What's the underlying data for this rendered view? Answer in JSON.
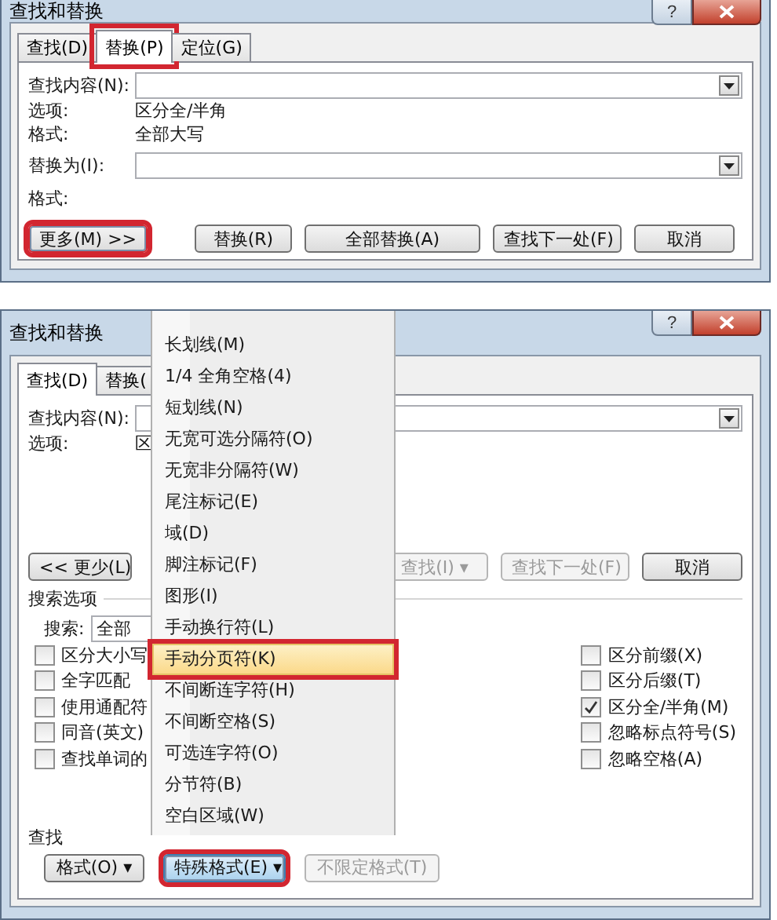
{
  "top_dialog": {
    "title": "查找和替换",
    "help": "?",
    "tabs": [
      {
        "label": "查找(D)",
        "selected": false,
        "highlighted": false
      },
      {
        "label": "替换(P)",
        "selected": true,
        "highlighted": true
      },
      {
        "label": "定位(G)",
        "selected": false,
        "highlighted": false
      }
    ],
    "find_label": "查找内容(N):",
    "options_label": "选项:",
    "options_value": "区分全/半角",
    "format_label": "格式:",
    "format_value": "全部大写",
    "replace_label": "替换为(I):",
    "replace_format_label": "格式:",
    "buttons": [
      {
        "label": "更多(M) >>",
        "highlighted": true,
        "disabled": false
      },
      {
        "label": "替换(R)",
        "highlighted": false,
        "disabled": false
      },
      {
        "label": "全部替换(A)",
        "highlighted": false,
        "disabled": false
      },
      {
        "label": "查找下一处(F)",
        "highlighted": false,
        "disabled": false
      },
      {
        "label": "取消",
        "highlighted": false,
        "disabled": false
      }
    ]
  },
  "bottom_dialog": {
    "title": "查找和替换",
    "help": "?",
    "tabs": [
      {
        "label": "查找(D)",
        "selected": true
      },
      {
        "label": "替换(",
        "selected": false
      }
    ],
    "find_label": "查找内容(N):",
    "options_label": "选项:",
    "options_value": "区",
    "less_button": "<< 更少(L)",
    "right_buttons": [
      {
        "label": "查找(I) ▾",
        "disabled": true
      },
      {
        "label": "查找下一处(F)",
        "disabled": true
      },
      {
        "label": "取消",
        "disabled": false
      }
    ],
    "search_options_title": "搜索选项",
    "search_label": "搜索:",
    "search_value": "全部",
    "left_checks": [
      {
        "label": "区分大小写",
        "checked": false
      },
      {
        "label": "全字匹配",
        "checked": false
      },
      {
        "label": "使用通配符",
        "checked": false
      },
      {
        "label": "同音(英文)",
        "checked": false
      },
      {
        "label": "查找单词的",
        "checked": false
      }
    ],
    "right_checks": [
      {
        "label": "区分前缀(X)",
        "checked": false
      },
      {
        "label": "区分后缀(T)",
        "checked": false
      },
      {
        "label": "区分全/半角(M)",
        "checked": true
      },
      {
        "label": "忽略标点符号(S)",
        "checked": false
      },
      {
        "label": "忽略空格(A)",
        "checked": false
      }
    ],
    "find_section_label": "查找",
    "bottom_buttons": [
      {
        "label": "格式(O) ▾",
        "pressed": false,
        "highlighted": false,
        "disabled": false
      },
      {
        "label": "特殊格式(E) ▾",
        "pressed": true,
        "highlighted": true,
        "disabled": false
      },
      {
        "label": "不限定格式(T)",
        "pressed": false,
        "highlighted": false,
        "disabled": true
      }
    ],
    "menu": [
      {
        "label": "长划线(M)",
        "selected": false,
        "highlighted": false
      },
      {
        "label": "1/4 全角空格(4)",
        "selected": false,
        "highlighted": false
      },
      {
        "label": "短划线(N)",
        "selected": false,
        "highlighted": false
      },
      {
        "label": "无宽可选分隔符(O)",
        "selected": false,
        "highlighted": false
      },
      {
        "label": "无宽非分隔符(W)",
        "selected": false,
        "highlighted": false
      },
      {
        "label": "尾注标记(E)",
        "selected": false,
        "highlighted": false
      },
      {
        "label": "域(D)",
        "selected": false,
        "highlighted": false
      },
      {
        "label": "脚注标记(F)",
        "selected": false,
        "highlighted": false
      },
      {
        "label": "图形(I)",
        "selected": false,
        "highlighted": false
      },
      {
        "label": "手动换行符(L)",
        "selected": false,
        "highlighted": false
      },
      {
        "label": "手动分页符(K)",
        "selected": true,
        "highlighted": true
      },
      {
        "label": "不间断连字符(H)",
        "selected": false,
        "highlighted": false
      },
      {
        "label": "不间断空格(S)",
        "selected": false,
        "highlighted": false
      },
      {
        "label": "可选连字符(O)",
        "selected": false,
        "highlighted": false
      },
      {
        "label": "分节符(B)",
        "selected": false,
        "highlighted": false
      },
      {
        "label": "空白区域(W)",
        "selected": false,
        "highlighted": false
      }
    ]
  }
}
